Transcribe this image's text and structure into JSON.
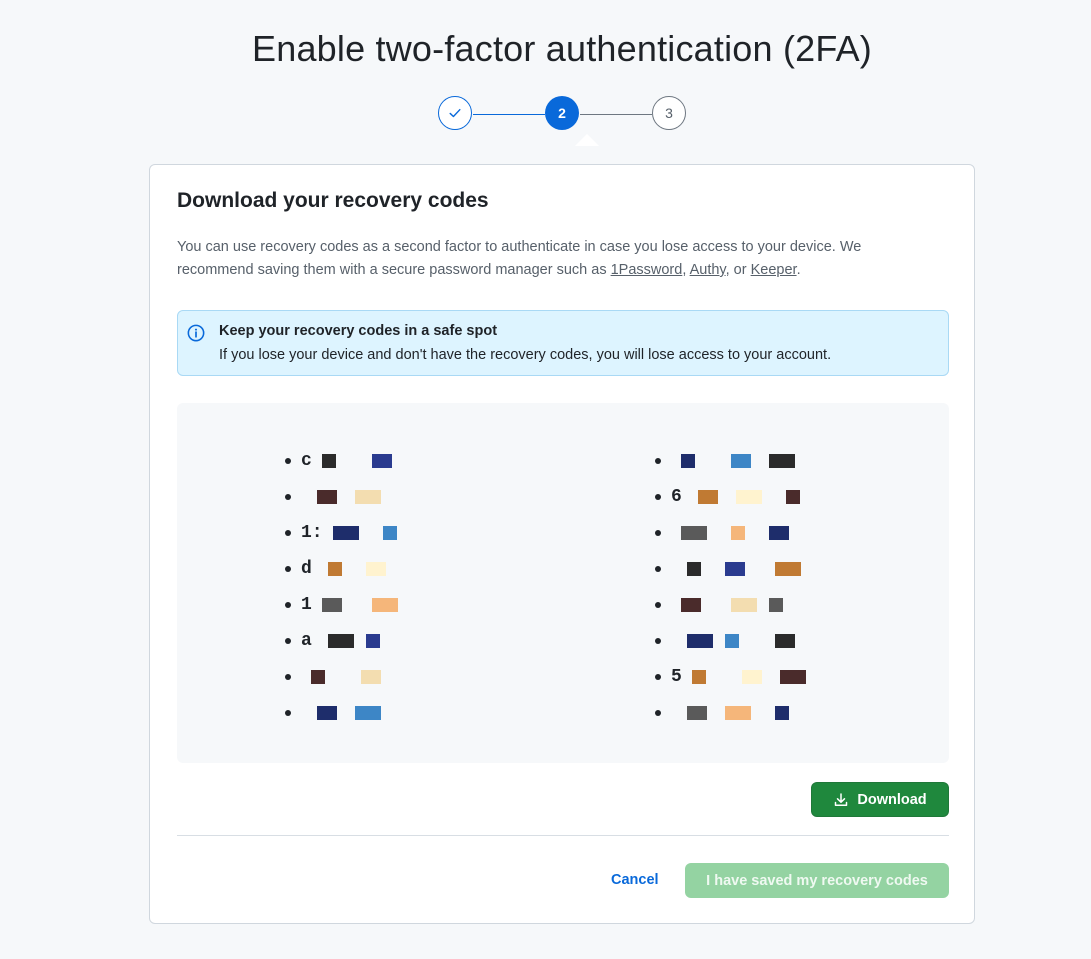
{
  "page": {
    "title": "Enable two-factor authentication (2FA)"
  },
  "stepper": {
    "steps": [
      {
        "label": "",
        "state": "complete",
        "icon": "check-icon"
      },
      {
        "label": "2",
        "state": "current"
      },
      {
        "label": "3",
        "state": "upcoming"
      }
    ]
  },
  "card": {
    "title": "Download your recovery codes",
    "description_prefix": "You can use recovery codes as a second factor to authenticate in case you lose access to your device. We recommend saving them with a secure password manager such as ",
    "links": [
      "1Password",
      "Authy",
      "Keeper"
    ],
    "sep1": ", ",
    "sep2": ", or ",
    "suffix": "."
  },
  "flash": {
    "icon": "info-icon",
    "title": "Keep your recovery codes in a safe spot",
    "text": "If you lose your device and don't have the recovery codes, you will lose access to your account."
  },
  "recovery_codes": {
    "note": "codes are obscured in the screenshot",
    "left": [
      "c",
      "",
      "1:",
      "d",
      "1",
      "a",
      "",
      ""
    ],
    "right": [
      "",
      "6",
      "",
      "",
      "",
      "",
      "5",
      ""
    ]
  },
  "actions": {
    "download_label": "Download",
    "download_icon": "download-icon",
    "cancel_label": "Cancel",
    "saved_label": "I have saved my recovery codes"
  },
  "colors": {
    "accent": "#0969da",
    "primary_button": "#1f883d",
    "disabled_button": "#94d3a2",
    "flash_bg": "#ddf4ff"
  }
}
